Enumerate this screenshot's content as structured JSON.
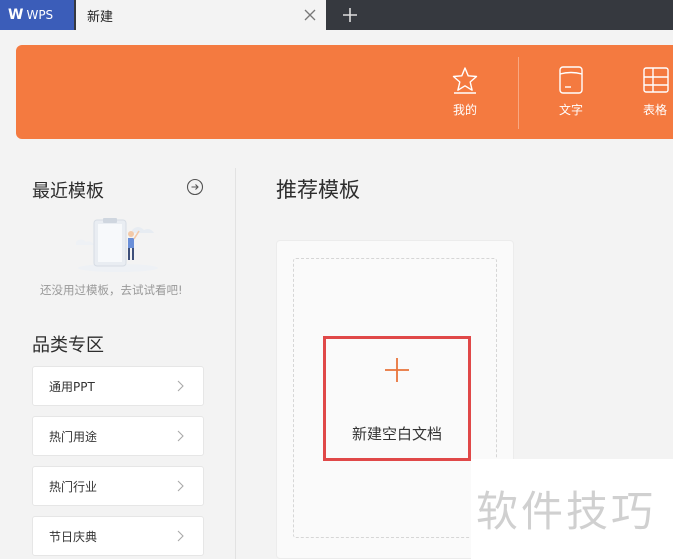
{
  "tabbar": {
    "app_tab_label": "WPS",
    "doc_tab_label": "新建"
  },
  "banner": {
    "items": [
      {
        "label": "我的",
        "icon": "star-icon"
      },
      {
        "label": "文字",
        "icon": "document-icon"
      },
      {
        "label": "表格",
        "icon": "spreadsheet-icon"
      }
    ]
  },
  "sidebar": {
    "recent_title": "最近模板",
    "empty_text": "还没用过模板，去试试看吧!",
    "category_title": "品类专区",
    "categories": [
      {
        "label": "通用PPT"
      },
      {
        "label": "热门用途"
      },
      {
        "label": "热门行业"
      },
      {
        "label": "节日庆典"
      }
    ]
  },
  "main": {
    "title": "推荐模板",
    "new_blank_label": "新建空白文档"
  },
  "watermark": "软件技巧",
  "colors": {
    "banner": "#f47a40",
    "wps_tab": "#3b5db9",
    "highlight": "#e04848",
    "plus": "#e8743b"
  }
}
